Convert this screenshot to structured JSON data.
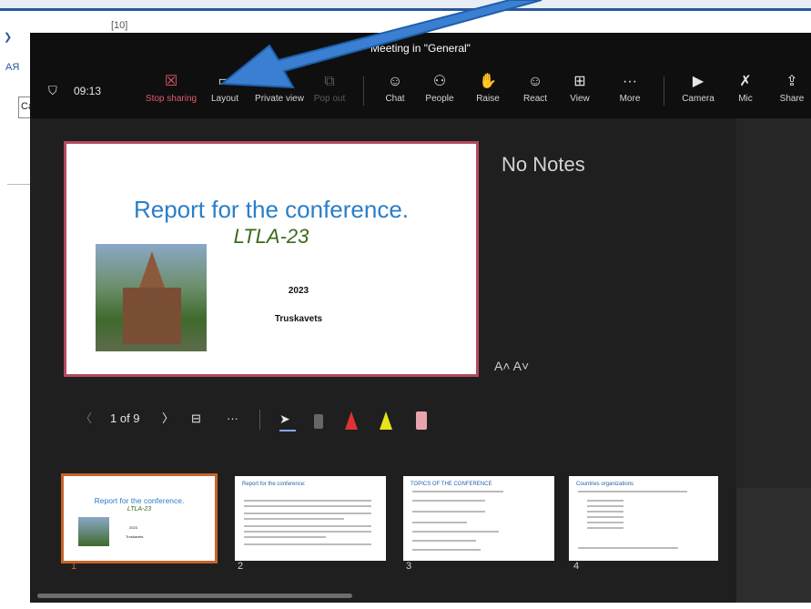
{
  "window_title": "Meeting in \"General\"",
  "timer": "09:13",
  "bg": {
    "fragment1": "АЯ",
    "cell_text": "Ca",
    "top_num": "[10]"
  },
  "toolbar": {
    "stop_sharing": "Stop sharing",
    "layout": "Layout",
    "private_view": "Private view",
    "pop_out": "Pop out",
    "chat": "Chat",
    "people": "People",
    "raise": "Raise",
    "react": "React",
    "view": "View",
    "more": "More",
    "camera": "Camera",
    "mic": "Mic",
    "share": "Share"
  },
  "slide": {
    "title": "Report for the conference.",
    "subtitle": "LTLA-23",
    "year": "2023",
    "place": "Truskavets"
  },
  "notes": "No Notes",
  "font_size_controls": "A˄  A˅",
  "pager": {
    "label": "1 of 9"
  },
  "thumbnails": [
    {
      "num": "1",
      "title": "Report for the conference.",
      "sub": "LTLA-23",
      "year": "2023",
      "place": "Truskavets"
    },
    {
      "num": "2",
      "title": "Report for the conference:"
    },
    {
      "num": "3",
      "title": "TOPICS OF THE CONFERENCE"
    },
    {
      "num": "4",
      "title": "Countries   organizations"
    }
  ],
  "colors": {
    "accent_red": "#e25a6b",
    "thumb_selected": "#c8642a",
    "arrow": "#3a7fd1"
  }
}
